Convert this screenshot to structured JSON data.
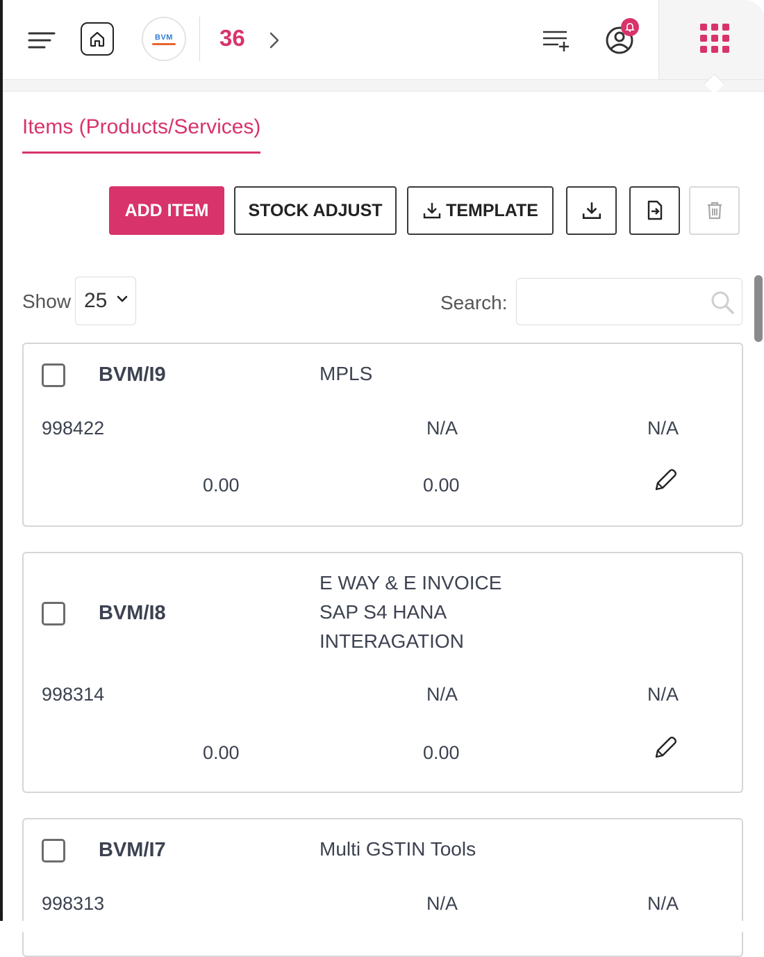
{
  "header": {
    "logo_text": "BVM",
    "count": "36",
    "icons": [
      "menu-icon",
      "home-icon",
      "chevron-right-icon",
      "add-list-icon",
      "user-notification-icon",
      "apps-grid-icon"
    ],
    "accent": "#d8336b"
  },
  "tab": {
    "label": "Items (Products/Services)"
  },
  "actions": {
    "add_item": "ADD ITEM",
    "stock_adjust": "STOCK ADJUST",
    "template": "TEMPLATE"
  },
  "table_controls": {
    "show_label": "Show",
    "page_size": "25",
    "search_label": "Search:",
    "search_value": ""
  },
  "items": [
    {
      "code": "BVM/I9",
      "name_lines": [
        "MPLS"
      ],
      "hsn": "998422",
      "col_a": "N/A",
      "col_b": "N/A",
      "val_a": "0.00",
      "val_b": "0.00"
    },
    {
      "code": "BVM/I8",
      "name_lines": [
        "E WAY & E INVOICE",
        "SAP S4 HANA",
        "INTERAGATION"
      ],
      "hsn": "998314",
      "col_a": "N/A",
      "col_b": "N/A",
      "val_a": "0.00",
      "val_b": "0.00"
    },
    {
      "code": "BVM/I7",
      "name_lines": [
        "Multi GSTIN Tools"
      ],
      "hsn": "998313",
      "col_a": "N/A",
      "col_b": "N/A"
    }
  ]
}
